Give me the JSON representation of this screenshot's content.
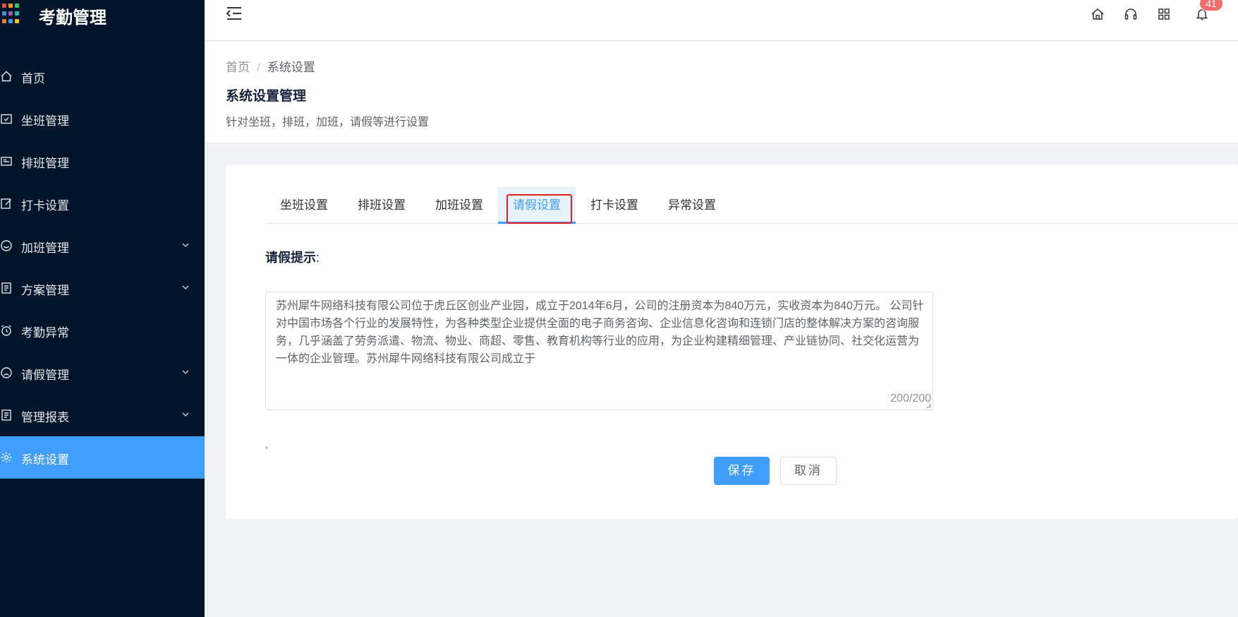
{
  "app": {
    "title": "考勤管理",
    "logo_colors": [
      "#e74c3c",
      "#f39c12",
      "#2ecc71",
      "#3498db",
      "#9b59b6",
      "#1abc9c",
      "#e67e22",
      "#409eff",
      "#f1c40f"
    ]
  },
  "sidebar": {
    "items": [
      {
        "label": "首页",
        "icon": "home-icon",
        "has_arrow": false
      },
      {
        "label": "坐班管理",
        "icon": "calendar-check-icon",
        "has_arrow": false
      },
      {
        "label": "排班管理",
        "icon": "schedule-icon",
        "has_arrow": false
      },
      {
        "label": "打卡设置",
        "icon": "edit-icon",
        "has_arrow": false
      },
      {
        "label": "加班管理",
        "icon": "smile-icon",
        "has_arrow": true
      },
      {
        "label": "方案管理",
        "icon": "document-icon",
        "has_arrow": true
      },
      {
        "label": "考勤异常",
        "icon": "alarm-icon",
        "has_arrow": false
      },
      {
        "label": "请假管理",
        "icon": "sad-face-icon",
        "has_arrow": true
      },
      {
        "label": "管理报表",
        "icon": "report-icon",
        "has_arrow": true
      },
      {
        "label": "系统设置",
        "icon": "gear-icon",
        "has_arrow": false,
        "active": true
      }
    ]
  },
  "header": {
    "notification_count": "41",
    "accent": "#409eff"
  },
  "breadcrumb": {
    "home": "首页",
    "separator": "/",
    "current": "系统设置"
  },
  "page": {
    "title": "系统设置管理",
    "description": "针对坐班，排班，加班，请假等进行设置"
  },
  "tabs": [
    {
      "label": "坐班设置"
    },
    {
      "label": "排班设置"
    },
    {
      "label": "加班设置"
    },
    {
      "label": "请假设置",
      "active": true
    },
    {
      "label": "打卡设置"
    },
    {
      "label": "异常设置"
    }
  ],
  "form": {
    "label": "请假提示",
    "colon": ":",
    "text": "苏州犀牛网络科技有限公司位于虎丘区创业产业园，成立于2014年6月，公司的注册资本为840万元，实收资本为840万元。 公司针对中国市场各个行业的发展特性，为各种类型企业提供全面的电子商务咨询、企业信息化咨询和连锁门店的整体解决方案的咨询服务，几乎涵盖了劳务派遣、物流、物业、商超、零售、教育机构等行业的应用，为企业构建精细管理、产业链协同、社交化运营为一体的企业管理。苏州犀牛网络科技有限公司成立于",
    "counter": "200/200",
    "stray_mark": ",",
    "save_label": "保存",
    "cancel_label": "取消"
  }
}
